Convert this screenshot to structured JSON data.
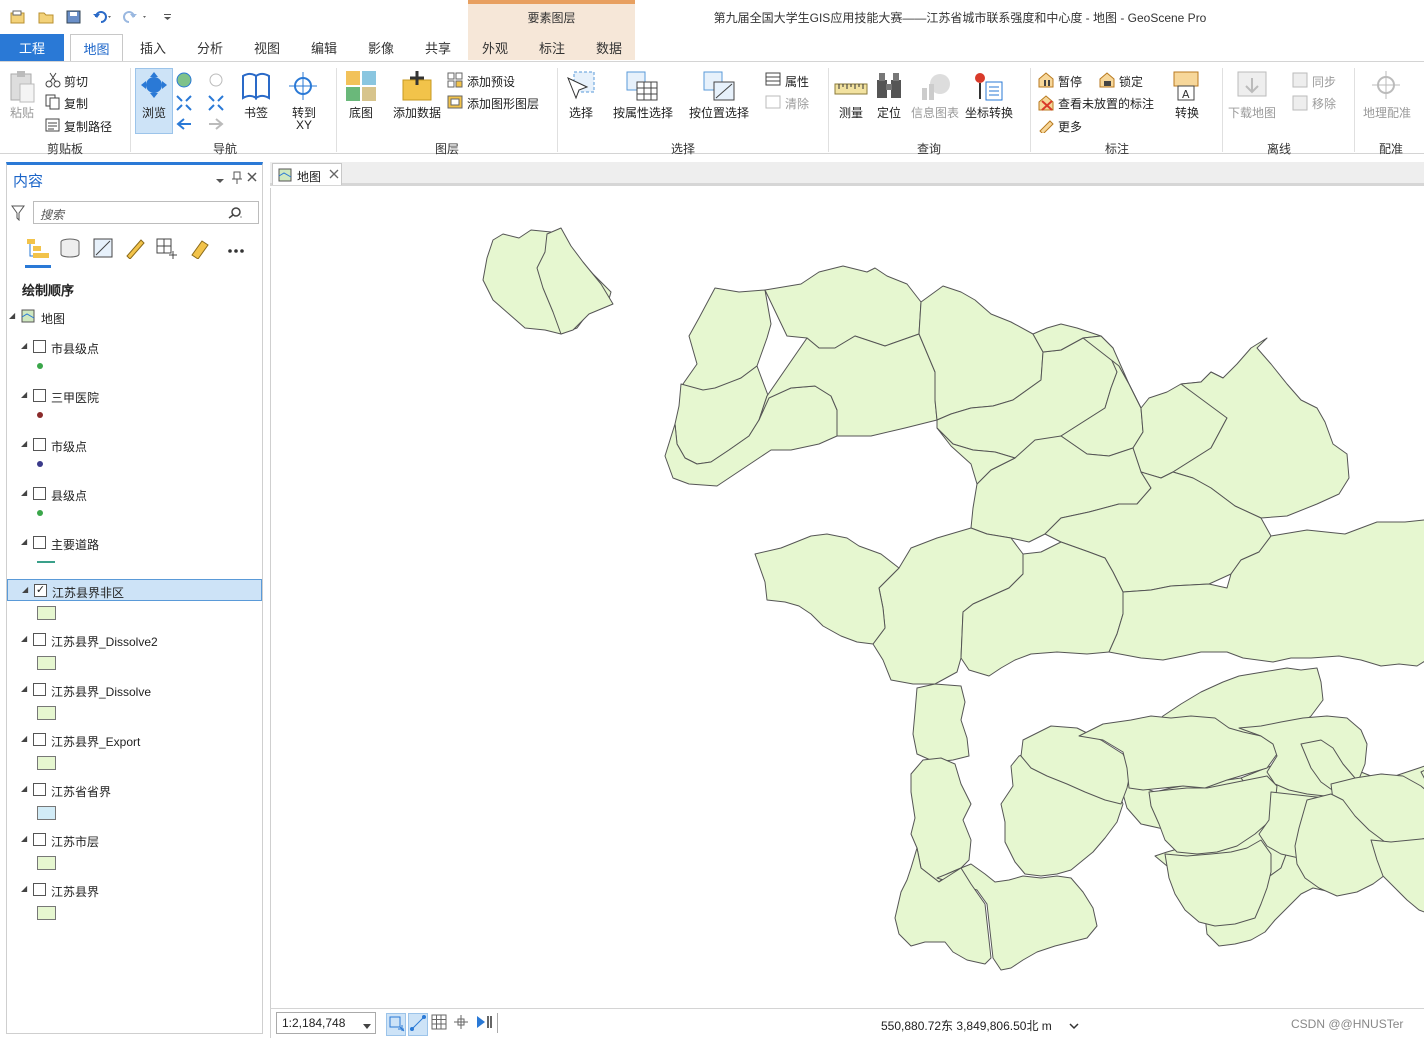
{
  "title_bar": {
    "window_title": "第九届全国大学生GIS应用技能大赛——江苏省城市联系强度和中心度 - 地图 - GeoScene Pro",
    "context_tab_group": "要素图层"
  },
  "ribbon_tabs": [
    "工程",
    "地图",
    "插入",
    "分析",
    "视图",
    "编辑",
    "影像",
    "共享",
    "外观",
    "标注",
    "数据"
  ],
  "ribbon": {
    "clipboard": {
      "paste": "粘贴",
      "cut": "剪切",
      "copy": "复制",
      "copy_path": "复制路径",
      "group": "剪贴板"
    },
    "navigate": {
      "explore": "浏览",
      "bookmarks": "书签",
      "goto_xy_1": "转到",
      "goto_xy_2": "XY",
      "group": "导航"
    },
    "layer": {
      "basemap": "底图",
      "add_data": "添加数据",
      "add_preset": "添加预设",
      "add_graphics_layer": "添加图形图层",
      "group": "图层"
    },
    "selection": {
      "select": "选择",
      "select_by_attributes": "按属性选择",
      "select_by_location": "按位置选择",
      "attributes": "属性",
      "clear": "清除",
      "group": "选择"
    },
    "inquiry": {
      "measure": "测量",
      "locate": "定位",
      "infographics": "信息图表",
      "convert_coords": "坐标转换",
      "group": "查询"
    },
    "labeling": {
      "pause": "暂停",
      "lock": "锁定",
      "view_unplaced": "查看未放置的标注",
      "more": "更多",
      "convert": "转换",
      "group": "标注"
    },
    "offline": {
      "download_map": "下载地图",
      "sync": "同步",
      "remove": "移除",
      "group": "离线"
    },
    "georeference": {
      "georeference": "地理配准",
      "group": "配准"
    }
  },
  "contents_pane": {
    "title": "内容",
    "search_placeholder": "搜索",
    "drawing_order": "绘制顺序",
    "map_name": "地图",
    "layers": [
      {
        "name": "市县级点",
        "checked": false,
        "symbol": "point",
        "color": "#3aa64a"
      },
      {
        "name": "三甲医院",
        "checked": false,
        "symbol": "point",
        "color": "#8a2a2a"
      },
      {
        "name": "市级点",
        "checked": false,
        "symbol": "point",
        "color": "#3a3a8a"
      },
      {
        "name": "县级点",
        "checked": false,
        "symbol": "point",
        "color": "#3aa64a"
      },
      {
        "name": "主要道路",
        "checked": false,
        "symbol": "line",
        "color": "#3aa08a"
      },
      {
        "name": "江苏县界非区",
        "checked": true,
        "symbol": "polygon",
        "color": "#e6f7d0",
        "selected": true
      },
      {
        "name": "江苏县界_Dissolve2",
        "checked": false,
        "symbol": "polygon",
        "color": "#e6f7d0"
      },
      {
        "name": "江苏县界_Dissolve",
        "checked": false,
        "symbol": "polygon",
        "color": "#e6f7d0"
      },
      {
        "name": "江苏县界_Export",
        "checked": false,
        "symbol": "polygon",
        "color": "#e6f7d0"
      },
      {
        "name": "江苏省省界",
        "checked": false,
        "symbol": "polygon",
        "color": "#d2ecf7"
      },
      {
        "name": "江苏市层",
        "checked": false,
        "symbol": "polygon",
        "color": "#e6f7d0"
      },
      {
        "name": "江苏县界",
        "checked": false,
        "symbol": "polygon",
        "color": "#e6f7d0"
      }
    ]
  },
  "map_view": {
    "tab_label": "地图",
    "scale": "1:2,184,748",
    "coordinates": "550,880.72东 3,849,806.50北 m",
    "watermark": "CSDN @@HNUSTer",
    "polygon_fill": "#e6f7d0",
    "polygon_stroke": "#555555"
  }
}
